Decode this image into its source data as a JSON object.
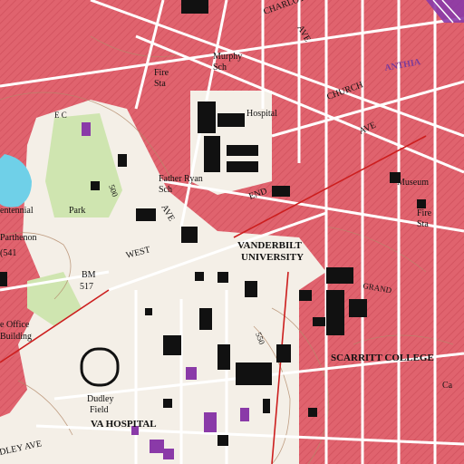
{
  "map": {
    "colors": {
      "urban": "#e0636e",
      "urban_light": "#f0a9ae",
      "paper": "#f4efe7",
      "park": "#cfe5b0",
      "water": "#6fd0e8",
      "building": "#111111",
      "purple": "#8a3aa8",
      "road": "#ffffff",
      "contour": "#b38a6a",
      "rail": "#cc1e1e"
    },
    "labels": {
      "charlotte": "CHARLOTTE",
      "church": "CHURCH",
      "murphy": "Murphy",
      "murphy_sch": "Sch",
      "fire_sta_1": "Fire",
      "fire_sta_1b": "Sta",
      "hospital": "Hospital",
      "ave_top": "AVE",
      "ave_right": "AVE",
      "ave_central": "AVE",
      "father_ryan": "Father Ryan",
      "father_ryan_sch": "Sch",
      "end": "END",
      "centennial": "entennial",
      "park": "Park",
      "parthenon": "Parthenon",
      "bm541": "(541",
      "west": "WEST",
      "vanderbilt_1": "VANDERBILT",
      "vanderbilt_2": "UNIVERSITY",
      "museum": "Museum",
      "fire_sta_2": "Fire",
      "fire_sta_2b": "Sta",
      "bm517_a": "BM",
      "bm517_b": "517",
      "state_office_1": "e Office",
      "state_office_2": "Building",
      "grand": "GRAND",
      "scarritt": "SCARRITT COLLEGE",
      "dudley_1": "Dudley",
      "dudley_2": "Field",
      "va_hospital": "VA HOSPITAL",
      "dley_ave": "DLEY AVE",
      "contour_500": "500",
      "contour_550": "550",
      "ca": "Ca",
      "ec": "E C",
      "purple_top": "ANTHIA"
    }
  }
}
